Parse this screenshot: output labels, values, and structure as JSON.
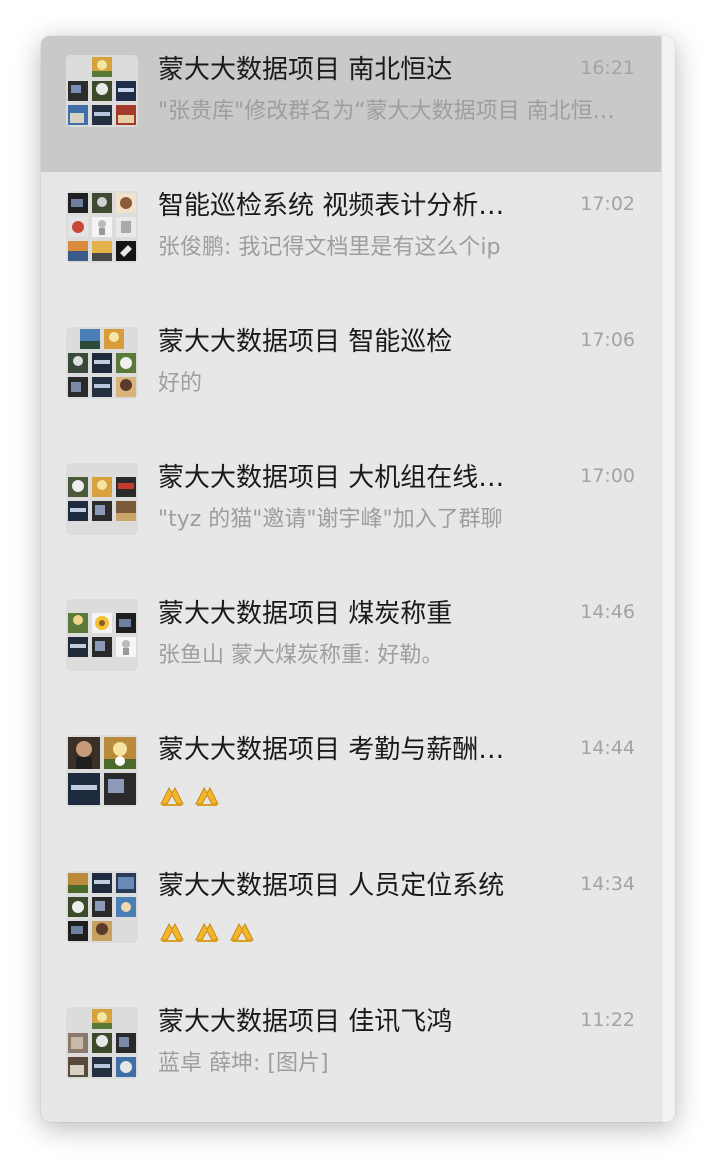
{
  "chats": [
    {
      "title": "蒙大大数据项目 南北恒达",
      "time": "16:21",
      "preview": "\"张贵库\"修改群名为“蒙大大数据项目 南北恒达”",
      "selected": true
    },
    {
      "title": "智能巡检系统 视频表计分析…",
      "time": "17:02",
      "preview": "张俊鹏: 我记得文档里是有这么个ip",
      "selected": false
    },
    {
      "title": "蒙大大数据项目 智能巡检",
      "time": "17:06",
      "preview": "好的",
      "selected": false
    },
    {
      "title": "蒙大大数据项目 大机组在线…",
      "time": "17:00",
      "preview": "\"tyz 的猫\"邀请\"谢宇峰\"加入了群聊",
      "selected": false
    },
    {
      "title": "蒙大大数据项目 煤炭称重",
      "time": "14:46",
      "preview": "张鱼山 蒙大煤炭称重: 好勒。",
      "selected": false
    },
    {
      "title": "蒙大大数据项目 考勤与薪酬…",
      "time": "14:44",
      "preview_emoji": "pray-hands-icon",
      "preview_emoji_count": 2,
      "selected": false
    },
    {
      "title": "蒙大大数据项目 人员定位系统",
      "time": "14:34",
      "preview_emoji": "pray-hands-icon",
      "preview_emoji_count": 3,
      "selected": false
    },
    {
      "title": "蒙大大数据项目 佳讯飞鸿",
      "time": "11:22",
      "preview": "蓝卓 薛坤: [图片]",
      "selected": false
    }
  ],
  "colors": {
    "list_background": "#e7e7e7",
    "selected_background": "#c9c9c9",
    "title_text": "#1a1a1a",
    "secondary_text": "#9e9e9e"
  }
}
